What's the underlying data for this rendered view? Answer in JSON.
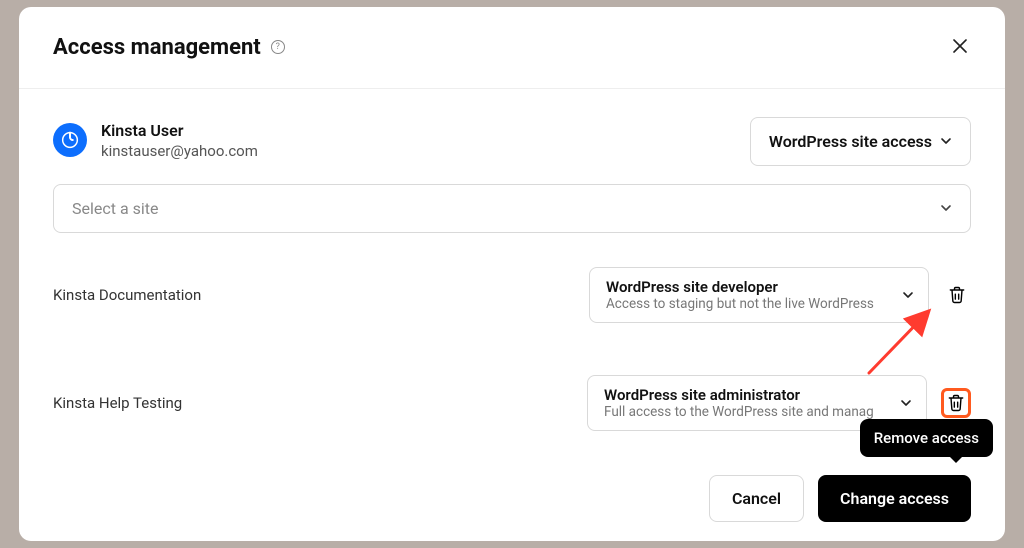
{
  "header": {
    "title": "Access management"
  },
  "user": {
    "name": "Kinsta User",
    "email": "kinstauser@yahoo.com",
    "access_type": "WordPress site access"
  },
  "select_site_placeholder": "Select a site",
  "sites": [
    {
      "name": "Kinsta Documentation",
      "role_title": "WordPress site developer",
      "role_desc": "Access to staging but not the live WordPress"
    },
    {
      "name": "Kinsta Help Testing",
      "role_title": "WordPress site administrator",
      "role_desc": "Full access to the WordPress site and manag"
    }
  ],
  "tooltip_text": "Remove access",
  "footer": {
    "cancel": "Cancel",
    "change": "Change access"
  }
}
